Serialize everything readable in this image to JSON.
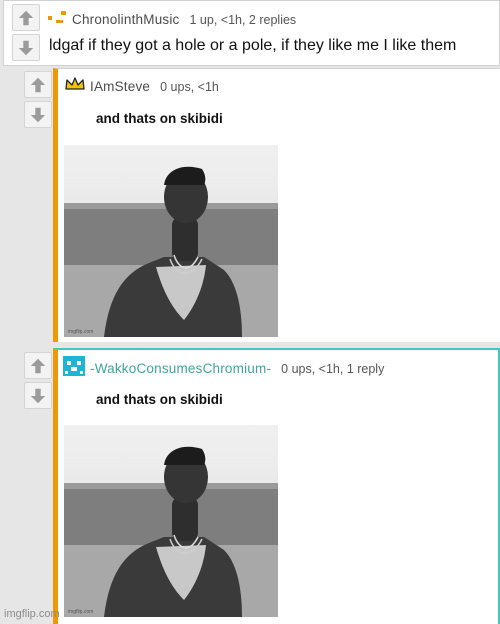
{
  "comments": [
    {
      "username": "ChronolinthMusic",
      "meta": "1 up, <1h, 2 replies",
      "text": "ldgaf if they got a hole or a pole, if they like me I like them",
      "flair_icon": "pixel-dashes-icon"
    },
    {
      "username": "IAmSteve",
      "meta": "0 ups, <1h",
      "text": "and thats on skibidi",
      "flair_icon": "crown-icon",
      "image": "shirtless-man-on-beach-photo"
    },
    {
      "username": "-WakkoConsumesChromium-",
      "meta": "0 ups, <1h, 1 reply",
      "text": "and thats on skibidi",
      "flair_icon": "pixel-ghost-icon",
      "image": "shirtless-man-on-beach-photo"
    }
  ],
  "colors": {
    "reply_thread_bar": "#f0960a",
    "highlight_border": "#44c7c2",
    "teal_username": "#3fa59a"
  },
  "watermark": "imgflip.com"
}
